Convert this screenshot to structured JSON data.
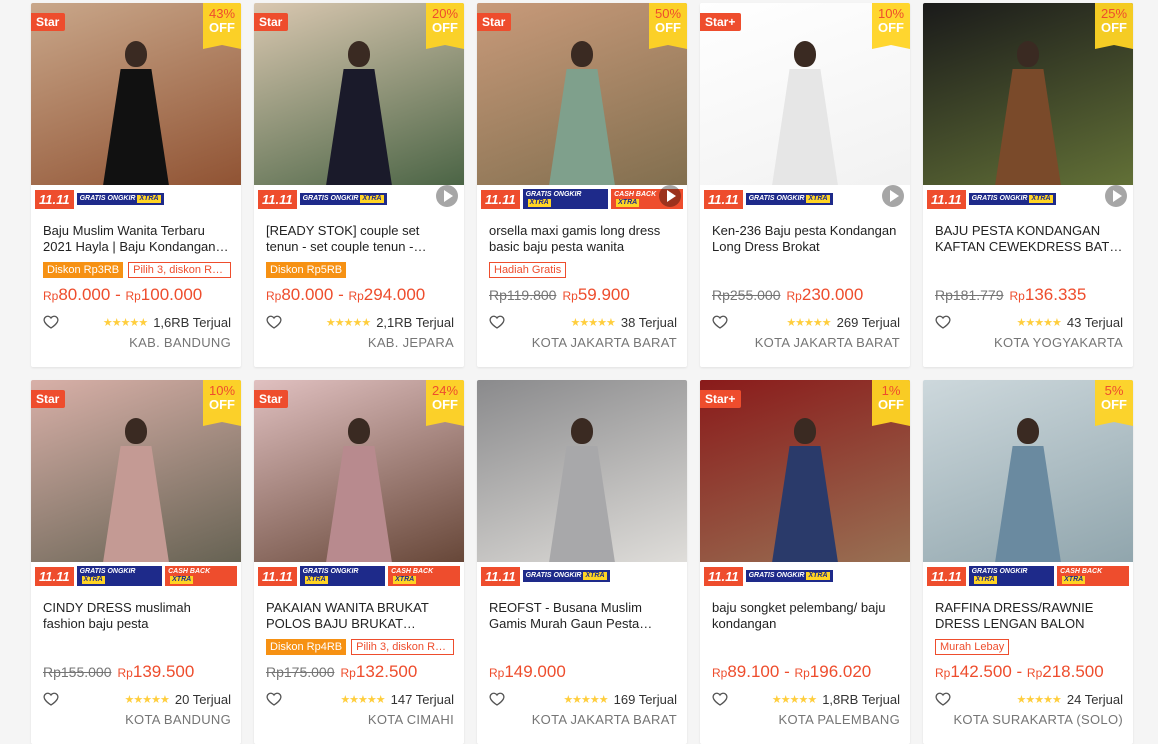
{
  "badges": {
    "star": "Star",
    "star_plus": "Star+",
    "campaign": "11.11",
    "gratis_top": "GRATIS",
    "gratis_bottom": "ONGKIR",
    "xtra": "XTRA",
    "cash_top": "CASH",
    "cash_bottom": "BACK",
    "off": "OFF",
    "currency": "Rp"
  },
  "products": [
    {
      "star": "Star",
      "discount": "43%",
      "title": "Baju Muslim Wanita Terbaru 2021 Hayla | Baju Kondangan Wanita",
      "badges": [
        {
          "text": "Diskon Rp3RB",
          "style": "fill"
        },
        {
          "text": "Pilih 3, diskon Rp5RB",
          "style": "line"
        }
      ],
      "old_price": "",
      "price_low": "80.000",
      "price_high": "100.000",
      "rating": "★★★★★",
      "sold": "1,6RB Terjual",
      "location": "KAB. BANDUNG",
      "cashback": false,
      "video": false,
      "colors": [
        "#8a4a2a",
        "#111111",
        "#c9a78a"
      ]
    },
    {
      "star": "Star",
      "discount": "20%",
      "title": "[READY STOK] couple set tenun - set couple tenun - kemeja tenun",
      "badges": [
        {
          "text": "Diskon Rp5RB",
          "style": "fill"
        }
      ],
      "old_price": "",
      "price_low": "80.000",
      "price_high": "294.000",
      "rating": "★★★★★",
      "sold": "2,1RB Terjual",
      "location": "KAB. JEPARA",
      "cashback": false,
      "video": true,
      "colors": [
        "#3c5a3a",
        "#1a1a2a",
        "#d9c7b0"
      ]
    },
    {
      "star": "Star",
      "discount": "50%",
      "title": "orsella maxi gamis long dress basic baju pesta wanita",
      "badges": [
        {
          "text": "Hadiah Gratis",
          "style": "line"
        }
      ],
      "old_price": "Rp119.800",
      "price_low": "59.900",
      "price_high": "",
      "rating": "★★★★★",
      "sold": "38 Terjual",
      "location": "KOTA JAKARTA BARAT",
      "cashback": true,
      "video": true,
      "colors": [
        "#7a6a4a",
        "#7fa08c",
        "#c89a7a"
      ]
    },
    {
      "star": "Star+",
      "discount": "10%",
      "title": "Ken-236 Baju pesta Kondangan Long Dress Brokat",
      "badges": [],
      "old_price": "Rp255.000",
      "price_low": "230.000",
      "price_high": "",
      "rating": "★★★★★",
      "sold": "269 Terjual",
      "location": "KOTA JAKARTA BARAT",
      "cashback": false,
      "video": true,
      "colors": [
        "#f0f0f0",
        "#e6e6e6",
        "#ffffff"
      ]
    },
    {
      "star": "",
      "discount": "25%",
      "title": "BAJU PESTA KONDANGAN KAFTAN CEWEKDRESS BATIK SATIN",
      "badges": [],
      "old_price": "Rp181.779",
      "price_low": "136.335",
      "price_high": "",
      "rating": "★★★★★",
      "sold": "43 Terjual",
      "location": "KOTA YOGYAKARTA",
      "cashback": false,
      "video": true,
      "colors": [
        "#6a7a3a",
        "#7a4a2a",
        "#1a1a1a"
      ]
    },
    {
      "star": "Star",
      "discount": "10%",
      "title": "CINDY DRESS muslimah fashion baju pesta",
      "badges": [],
      "old_price": "Rp155.000",
      "price_low": "139.500",
      "price_high": "",
      "rating": "★★★★★",
      "sold": "20 Terjual",
      "location": "KOTA BANDUNG",
      "cashback": true,
      "video": false,
      "colors": [
        "#5a5a4a",
        "#c49a94",
        "#d8b0a8"
      ]
    },
    {
      "star": "Star",
      "discount": "24%",
      "title": "PAKAIAN WANITA BRUKAT POLOS BAJU BRUKAT WANITA DRESS",
      "badges": [
        {
          "text": "Diskon Rp4RB",
          "style": "fill"
        },
        {
          "text": "Pilih 3, diskon Rp5RB",
          "style": "line"
        }
      ],
      "old_price": "Rp175.000",
      "price_low": "132.500",
      "price_high": "",
      "rating": "★★★★★",
      "sold": "147 Terjual",
      "location": "KOTA CIMAHI",
      "cashback": true,
      "video": false,
      "colors": [
        "#5a3a2a",
        "#b88a8e",
        "#e0c0c0"
      ]
    },
    {
      "star": "",
      "discount": "",
      "title": "REOFST - Busana Muslim Gamis Murah Gaun Pesta Wanita",
      "badges": [],
      "old_price": "",
      "price_low": "149.000",
      "price_high": "",
      "rating": "★★★★★",
      "sold": "169 Terjual",
      "location": "KOTA JAKARTA BARAT",
      "cashback": false,
      "video": false,
      "colors": [
        "#e8e6e2",
        "#a8a8aa",
        "#8a8a8c"
      ]
    },
    {
      "star": "Star+",
      "discount": "1%",
      "title": "baju songket pelembang/ baju kondangan",
      "badges": [],
      "old_price": "",
      "price_low": "89.100",
      "price_high": "196.020",
      "rating": "★★★★★",
      "sold": "1,8RB Terjual",
      "location": "KOTA PALEMBANG",
      "cashback": false,
      "video": false,
      "colors": [
        "#9a7a5a",
        "#2a3a6a",
        "#8a1a1a"
      ]
    },
    {
      "star": "",
      "discount": "5%",
      "title": "RAFFINA DRESS/RAWNIE DRESS LENGAN BALON",
      "badges": [
        {
          "text": "Murah Lebay",
          "style": "line"
        }
      ],
      "old_price": "",
      "price_low": "142.500",
      "price_high": "218.500",
      "rating": "★★★★★",
      "sold": "24 Terjual",
      "location": "KOTA SURAKARTA (SOLO)",
      "cashback": true,
      "video": false,
      "colors": [
        "#8aa0a8",
        "#6a8aa0",
        "#cdd8dc"
      ]
    }
  ]
}
